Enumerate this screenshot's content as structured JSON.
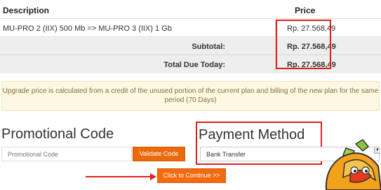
{
  "table": {
    "header_description": "Description",
    "header_price": "Price",
    "item_description": "MU-PRO 2 (IIX) 500 Mb => MU-PRO 3 (IIX) 1 Gb",
    "item_price": "Rp. 27.568,49",
    "subtotal_label": "Subtotal:",
    "subtotal_value": "Rp. 27.568,49",
    "total_due_label": "Total Due Today:",
    "total_due_value": "Rp. 27.568,49"
  },
  "notice": {
    "line1": "Upgrade price is calculated from a credit of the unused portion of the current plan and billing of the new plan for the same",
    "line2": "period (70 Days)"
  },
  "promo": {
    "title": "Promotional Code",
    "placeholder": "Promotional Code",
    "validate_label": "Validate Code"
  },
  "payment": {
    "title": "Payment Method",
    "selected": "Bank Transfer"
  },
  "actions": {
    "continue_label": "Click to Continue >>"
  },
  "colors": {
    "highlight_border": "#e02020",
    "button_orange": "#f26b10",
    "notice_bg": "#fcf8e3",
    "notice_text": "#8a6d3b"
  },
  "icons": {
    "dropdown": "chevron-down-icon",
    "mascot": "mascot-character-icon"
  }
}
